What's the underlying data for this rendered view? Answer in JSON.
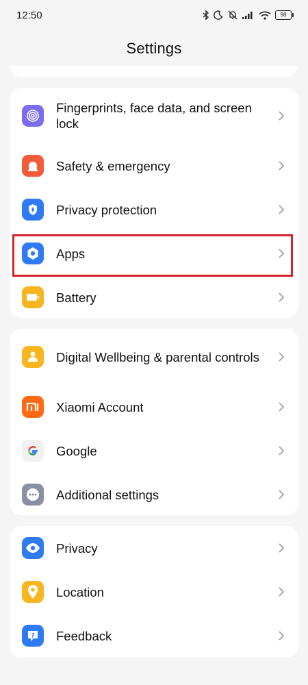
{
  "status": {
    "time": "12:50",
    "battery": "98"
  },
  "header": {
    "title": "Settings"
  },
  "groups": [
    {
      "items": [
        {
          "label": "Fingerprints, face data, and screen lock",
          "icon": "fingerprint-icon",
          "color": "#7c6cf0"
        },
        {
          "label": "Safety & emergency",
          "icon": "alarm-icon",
          "color": "#f25c3a"
        },
        {
          "label": "Privacy protection",
          "icon": "shield-icon",
          "color": "#2f7bf5"
        },
        {
          "label": "Apps",
          "icon": "apps-gear-icon",
          "color": "#2f7bf5",
          "highlighted": true
        },
        {
          "label": "Battery",
          "icon": "battery-icon",
          "color": "#f7b51f"
        }
      ]
    },
    {
      "items": [
        {
          "label": "Digital Wellbeing & parental controls",
          "icon": "wellbeing-icon",
          "color": "#f7b51f"
        },
        {
          "label": "Xiaomi Account",
          "icon": "mi-icon",
          "color": "#ff6a13"
        },
        {
          "label": "Google",
          "icon": "google-icon",
          "color": "#f1f1f1"
        },
        {
          "label": "Additional settings",
          "icon": "more-dots-icon",
          "color": "#8a8fa3"
        }
      ]
    },
    {
      "items": [
        {
          "label": "Privacy",
          "icon": "eye-icon",
          "color": "#2f7bf5"
        },
        {
          "label": "Location",
          "icon": "location-pin-icon",
          "color": "#f7b51f"
        },
        {
          "label": "Feedback",
          "icon": "feedback-icon",
          "color": "#2f7bf5"
        }
      ]
    }
  ]
}
